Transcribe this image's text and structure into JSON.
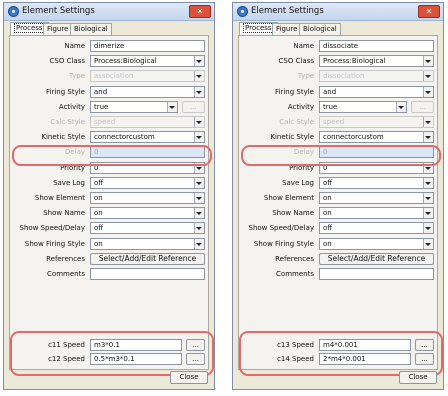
{
  "windows": [
    {
      "title": "Element Settings",
      "close_glyph": "✕",
      "tabs": [
        "Process",
        "Figure",
        "Biological"
      ],
      "rows": [
        {
          "label": "Name",
          "value": "dimerize",
          "type": "text"
        },
        {
          "label": "CSO Class",
          "value": "Process:Biological",
          "type": "select"
        },
        {
          "label": "Type",
          "value": "association",
          "type": "select",
          "disabled": true
        },
        {
          "label": "Firing Style",
          "value": "and",
          "type": "select"
        },
        {
          "label": "Activity",
          "value": "true",
          "type": "select-btn",
          "button": "..."
        },
        {
          "label": "Calc Style",
          "value": "speed",
          "type": "select",
          "disabled": true
        },
        {
          "label": "Kinetic Style",
          "value": "connectorcustom",
          "type": "select"
        },
        {
          "label": "Delay",
          "value": "0",
          "type": "text",
          "selected": true,
          "disabled_label": true
        },
        {
          "label": "Priority",
          "value": "0",
          "type": "select"
        },
        {
          "label": "Save Log",
          "value": "off",
          "type": "select"
        },
        {
          "label": "Show Element",
          "value": "on",
          "type": "select"
        },
        {
          "label": "Show Name",
          "value": "on",
          "type": "select"
        },
        {
          "label": "Show Speed/Delay",
          "value": "off",
          "type": "select"
        },
        {
          "label": "Show Firing Style",
          "value": "on",
          "type": "select"
        },
        {
          "label": "References",
          "button": "Select/Add/Edit Reference",
          "type": "button"
        },
        {
          "label": "Comments",
          "value": "",
          "type": "text"
        }
      ],
      "speeds": [
        {
          "label": "c11 Speed",
          "value": "m3*0.1",
          "button": "..."
        },
        {
          "label": "c12 Speed",
          "value": "0.5*m3*0.1",
          "button": "..."
        }
      ],
      "close_label": "Close"
    },
    {
      "title": "Element Settings",
      "close_glyph": "✕",
      "tabs": [
        "Process",
        "Figure",
        "Biological"
      ],
      "rows": [
        {
          "label": "Name",
          "value": "dissociate",
          "type": "text"
        },
        {
          "label": "CSO Class",
          "value": "Process:Biological",
          "type": "select"
        },
        {
          "label": "Type",
          "value": "dissociation",
          "type": "select",
          "disabled": true
        },
        {
          "label": "Firing Style",
          "value": "and",
          "type": "select"
        },
        {
          "label": "Activity",
          "value": "true",
          "type": "select-btn",
          "button": "..."
        },
        {
          "label": "Calc Style",
          "value": "speed",
          "type": "select",
          "disabled": true
        },
        {
          "label": "Kinetic Style",
          "value": "connectorcustom",
          "type": "select"
        },
        {
          "label": "Delay",
          "value": "0",
          "type": "text",
          "selected": true,
          "disabled_label": true
        },
        {
          "label": "Priority",
          "value": "0",
          "type": "select"
        },
        {
          "label": "Save Log",
          "value": "off",
          "type": "select"
        },
        {
          "label": "Show Element",
          "value": "on",
          "type": "select"
        },
        {
          "label": "Show Name",
          "value": "on",
          "type": "select"
        },
        {
          "label": "Show Speed/Delay",
          "value": "off",
          "type": "select"
        },
        {
          "label": "Show Firing Style",
          "value": "on",
          "type": "select"
        },
        {
          "label": "References",
          "button": "Select/Add/Edit Reference",
          "type": "button"
        },
        {
          "label": "Comments",
          "value": "",
          "type": "text"
        }
      ],
      "speeds": [
        {
          "label": "c13 Speed",
          "value": "m4*0.001",
          "button": "..."
        },
        {
          "label": "c14 Speed",
          "value": "2*m4*0.001",
          "button": "..."
        }
      ],
      "close_label": "Close"
    }
  ],
  "colors": {
    "highlight": "#e26a6a",
    "title_bar": "#c4d5ee",
    "close_button": "#d9533b"
  },
  "icons": [
    "app-icon",
    "close-icon",
    "dropdown-arrow-icon"
  ]
}
